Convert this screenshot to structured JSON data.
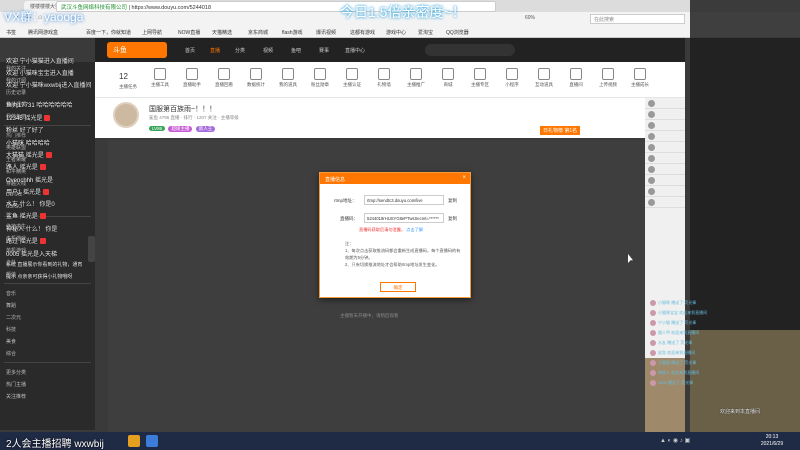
{
  "browser": {
    "tab_title": "楼楼楼楼大猫猫_斗鱼直播_斗鱼",
    "address_org": "武汉斗鱼网络科技有限公司",
    "address_url": "https://www.douyu.com/5244018",
    "zoom": "60%",
    "search_placeholder": "在此搜索",
    "bookmarks": [
      "书签",
      "腾讯网游戏盒",
      "百度一下，你就知道",
      "上网导航",
      "NOW直播",
      "天猫精选",
      "京东商城",
      "flash游戏",
      "爆讯视频",
      "这都有游戏",
      "游戏中心",
      "爱淘宝",
      "QQ浏览器"
    ]
  },
  "overlay": {
    "title": "今日1.5倍亲密度~！",
    "watermark": "VX群：yaooga"
  },
  "site_header": {
    "nav": [
      "首页",
      "直播",
      "分类",
      "视频",
      "鱼吧",
      "赛事",
      "直播中心"
    ],
    "active_index": 1
  },
  "toolbar": {
    "count": "12",
    "items": [
      "主播任务",
      "主播工具",
      "直播助手",
      "直播回看",
      "数据统计",
      "我的道具",
      "粉丝勋章",
      "主播认证",
      "礼物墙",
      "主播推广",
      "商城",
      "主播专区",
      "小程序",
      "互动道具",
      "直播间",
      "上传视频",
      "主播成长"
    ]
  },
  "room": {
    "title": "国服第百族雨~！！！",
    "meta": "鲨鱼 4796 直播 · 排行 · 1207 关注 · 主播等级",
    "tags": [
      "LV86",
      "超级主播",
      "新人王"
    ],
    "badge": "日礼物榜 第1名"
  },
  "sidebar": {
    "items": [
      "我的关注",
      "我的订阅",
      "历史记录",
      "我的视频",
      "我的鱼吧",
      "热门推荐",
      "英雄联盟",
      "王者荣耀",
      "和平精英",
      "穿越火线",
      "DOTA2",
      "CS:GO",
      "绝地求生",
      "主机游戏",
      "单机游戏",
      "户外",
      "颜值",
      "音乐",
      "舞蹈",
      "二次元",
      "科技",
      "美食",
      "综合",
      "更多分类",
      "热门主播",
      "关注推荐"
    ]
  },
  "modal": {
    "title": "直播信息",
    "rtmp_label": "rtmp地址：",
    "rtmp_value": "rtmp://sendtc3.douyu.com/live",
    "key_label": "直播码：",
    "key_value": "5244018rHUSYG8ePTwsSecret=******",
    "copy_label": "复制",
    "warn_text": "直播码获取后请勿泄露，",
    "warn_link": "点击了解",
    "notes_title": "注：",
    "notes": [
      "1、每次点击获取推流码都会重新生成直播码，每个直播码的有效期为5分钟。",
      "2、只有切换推流地址才会帮助rtmp地址发生变化。"
    ],
    "confirm_label": "确定"
  },
  "video": {
    "caption": "主播暂未开播中，请稍后观看"
  },
  "chat": {
    "lines": [
      {
        "user": "欢迎",
        "text": "宁小猫猫进入直播间"
      },
      {
        "user": "欢迎",
        "text": "小猫咪宝宝进入直播"
      },
      {
        "user": "欢迎",
        "text": "宁小猫咪wxwbij进入直播间"
      },
      {
        "user": "鱼丸17731",
        "text": "哈哈哈哈哈哈"
      },
      {
        "user": "12345",
        "text": "摇光是"
      },
      {
        "user": "粉丝",
        "text": "好了好了"
      },
      {
        "user": "小猫咪",
        "text": "哈哈哈哈"
      },
      {
        "user": "大猫猫",
        "text": "摇光是"
      },
      {
        "user": "路人",
        "text": "摇光是"
      },
      {
        "user": "Ovenchhh",
        "text": "摇光是"
      },
      {
        "user": "用户1",
        "text": "摇光是"
      },
      {
        "user": "水友",
        "text": "什么！ 你是0"
      },
      {
        "user": "鲨鱼",
        "text": "摇光是"
      },
      {
        "user": "神秘人",
        "text": "什么！ 你是"
      },
      {
        "user": "路过",
        "text": "摇光是"
      },
      {
        "user": "0005",
        "text": "摇光是入天梯"
      },
      {
        "user": "系统",
        "text": "直播展示你看到的礼物，通宵"
      },
      {
        "user": "提示",
        "text": "点亲亲可获得小礼物哦呀"
      }
    ],
    "gifts": [
      "小猫咪 赠送了 荧光棒",
      "小猫咪宝宝 欢迎来到直播间",
      "宁小猫 赠送了 荧光棒",
      "路人甲 欢迎来到直播间",
      "水友 赠送了 荧光棒",
      "鲨鱼 欢迎来到直播间",
      "大猫猫 赠送了 荧光棒",
      "神秘人 欢迎来到直播间",
      "0005 赠送了 荧光棒"
    ],
    "bottom_text": "欢迎来到本直播间"
  },
  "taskbar": {
    "label": "2人会主播招聘  wxwbij",
    "time": "20:13",
    "date": "2021/6/29"
  }
}
